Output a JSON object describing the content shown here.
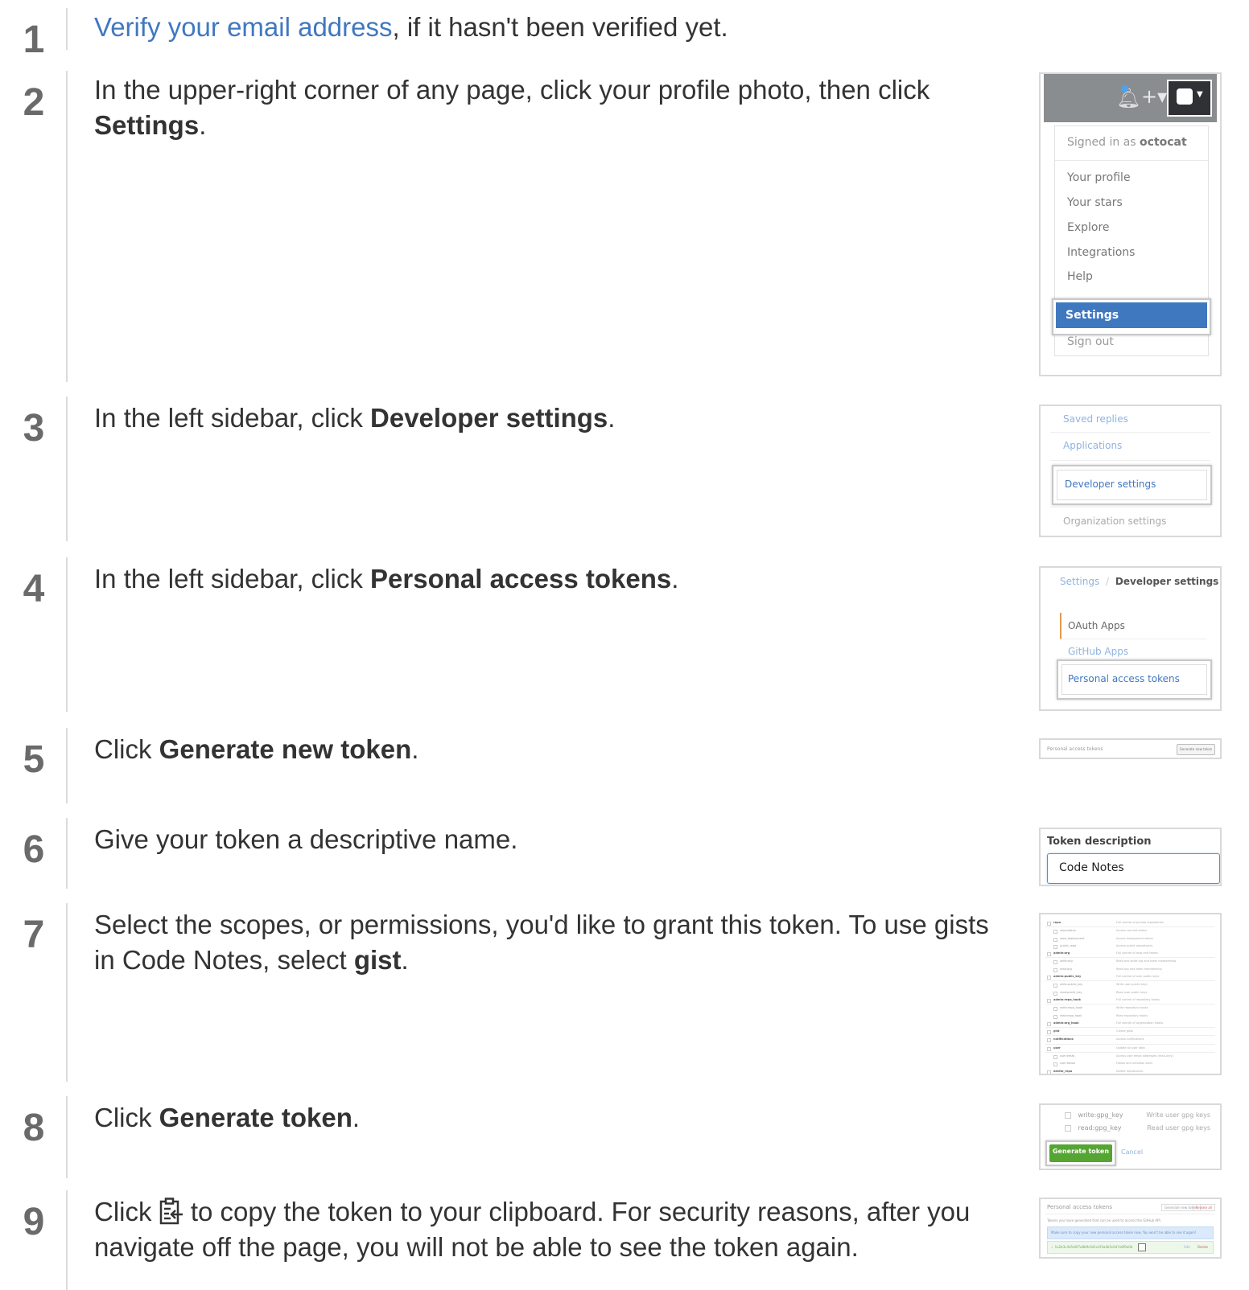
{
  "steps": [
    {
      "num": "1",
      "link": "Verify your email address",
      "text": ", if it hasn't been verified yet."
    },
    {
      "num": "2",
      "pre": "In the upper-right corner of any page, click your profile photo, then click ",
      "bold": "Settings",
      "post": "."
    },
    {
      "num": "3",
      "pre": "In the left sidebar, click ",
      "bold": "Developer settings",
      "post": "."
    },
    {
      "num": "4",
      "pre": "In the left sidebar, click ",
      "bold": "Personal access tokens",
      "post": "."
    },
    {
      "num": "5",
      "pre": "Click ",
      "bold": "Generate new token",
      "post": "."
    },
    {
      "num": "6",
      "pre": "Give your token a descriptive name."
    },
    {
      "num": "7",
      "pre": "Select the scopes, or permissions, you'd like to grant this token. To use gists in Code Notes, select ",
      "bold": "gist",
      "post": "."
    },
    {
      "num": "8",
      "pre": "Click ",
      "bold": "Generate token",
      "post": "."
    },
    {
      "num": "9",
      "pre": "Click ",
      "post": " to copy the token to your clipboard. For security reasons, after you navigate off the page, you will not be able to see the token again."
    }
  ],
  "shot2": {
    "signed_in": "Signed in as",
    "user": "octocat",
    "items": [
      "Your profile",
      "Your stars",
      "Explore",
      "Integrations",
      "Help"
    ],
    "settings": "Settings",
    "signout": "Sign out"
  },
  "shot3": {
    "items": [
      "Saved replies",
      "Applications",
      "Developer settings",
      "Organization settings"
    ]
  },
  "shot4": {
    "crumb1": "Settings",
    "sep": "/",
    "crumb2": "Developer settings",
    "items": [
      "OAuth Apps",
      "GitHub Apps",
      "Personal access tokens"
    ]
  },
  "shot5": {
    "label": "Personal access tokens",
    "button": "Generate new token"
  },
  "shot6": {
    "label": "Token description",
    "value": "Code Notes"
  },
  "shot7": {
    "scopes": [
      {
        "name": "repo",
        "desc": "Full control of private repositories",
        "main": true
      },
      {
        "name": "repo:status",
        "desc": "Access commit status",
        "main": false
      },
      {
        "name": "repo_deployment",
        "desc": "Access deployment status",
        "main": false
      },
      {
        "name": "public_repo",
        "desc": "Access public repositories",
        "main": false
      },
      {
        "name": "admin:org",
        "desc": "Full control of orgs and teams",
        "main": true
      },
      {
        "name": "write:org",
        "desc": "Read and write org and team membership",
        "main": false
      },
      {
        "name": "read:org",
        "desc": "Read org and team membership",
        "main": false
      },
      {
        "name": "admin:public_key",
        "desc": "Full control of user public keys",
        "main": true
      },
      {
        "name": "write:public_key",
        "desc": "Write user public keys",
        "main": false
      },
      {
        "name": "read:public_key",
        "desc": "Read user public keys",
        "main": false
      },
      {
        "name": "admin:repo_hook",
        "desc": "Full control of repository hooks",
        "main": true
      },
      {
        "name": "write:repo_hook",
        "desc": "Write repository hooks",
        "main": false
      },
      {
        "name": "read:repo_hook",
        "desc": "Read repository hooks",
        "main": false
      },
      {
        "name": "admin:org_hook",
        "desc": "Full control of organization hooks",
        "main": true
      },
      {
        "name": "gist",
        "desc": "Create gists",
        "main": true
      },
      {
        "name": "notifications",
        "desc": "Access notifications",
        "main": true
      },
      {
        "name": "user",
        "desc": "Update all user data",
        "main": true
      },
      {
        "name": "user:email",
        "desc": "Access user email addresses (read-only)",
        "main": false
      },
      {
        "name": "user:follow",
        "desc": "Follow and unfollow users",
        "main": false
      },
      {
        "name": "delete_repo",
        "desc": "Delete repositories",
        "main": true
      }
    ]
  },
  "shot8": {
    "rows": [
      {
        "name": "write:gpg_key",
        "desc": "Write user gpg keys"
      },
      {
        "name": "read:gpg_key",
        "desc": "Read user gpg keys"
      }
    ],
    "button": "Generate token",
    "cancel": "Cancel"
  },
  "shot9": {
    "title": "Personal access tokens",
    "btn1": "Generate new token",
    "btn2": "Revoke all",
    "info": "Tokens you have generated that can be used to access the GitHub API.",
    "notice": "Make sure to copy your new personal access token now. You won't be able to see it again!",
    "token": "✓ 1a2b3c4d5e6f7a8b9c0d1e2f3a4b5c6d7e8f9a0b",
    "edit": "Edit",
    "delete": "Delete"
  },
  "colors": {
    "link": "#4078c0",
    "highlight": "#4078c0",
    "green": "#55a532"
  }
}
